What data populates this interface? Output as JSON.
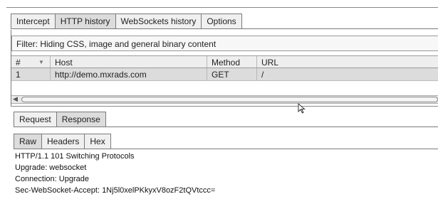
{
  "main_tabs": [
    "Intercept",
    "HTTP history",
    "WebSockets history",
    "Options"
  ],
  "active_main_tab": "HTTP history",
  "filter": {
    "text": "Filter: Hiding CSS, image and general binary content"
  },
  "table": {
    "columns": [
      "#",
      "Host",
      "Method",
      "URL"
    ],
    "rows": [
      {
        "num": "1",
        "host": "http://demo.mxrads.com",
        "method": "GET",
        "url": "/"
      }
    ]
  },
  "message_tabs": [
    "Request",
    "Response"
  ],
  "active_message_tab": "Response",
  "view_tabs": [
    "Raw",
    "Headers",
    "Hex"
  ],
  "active_view_tab": "Raw",
  "response_lines": [
    "HTTP/1.1 101 Switching Protocols",
    "Upgrade: websocket",
    "Connection: Upgrade",
    "Sec-WebSocket-Accept: 1Nj5l0xelPKkyxV8ozF2tQVtccc="
  ]
}
